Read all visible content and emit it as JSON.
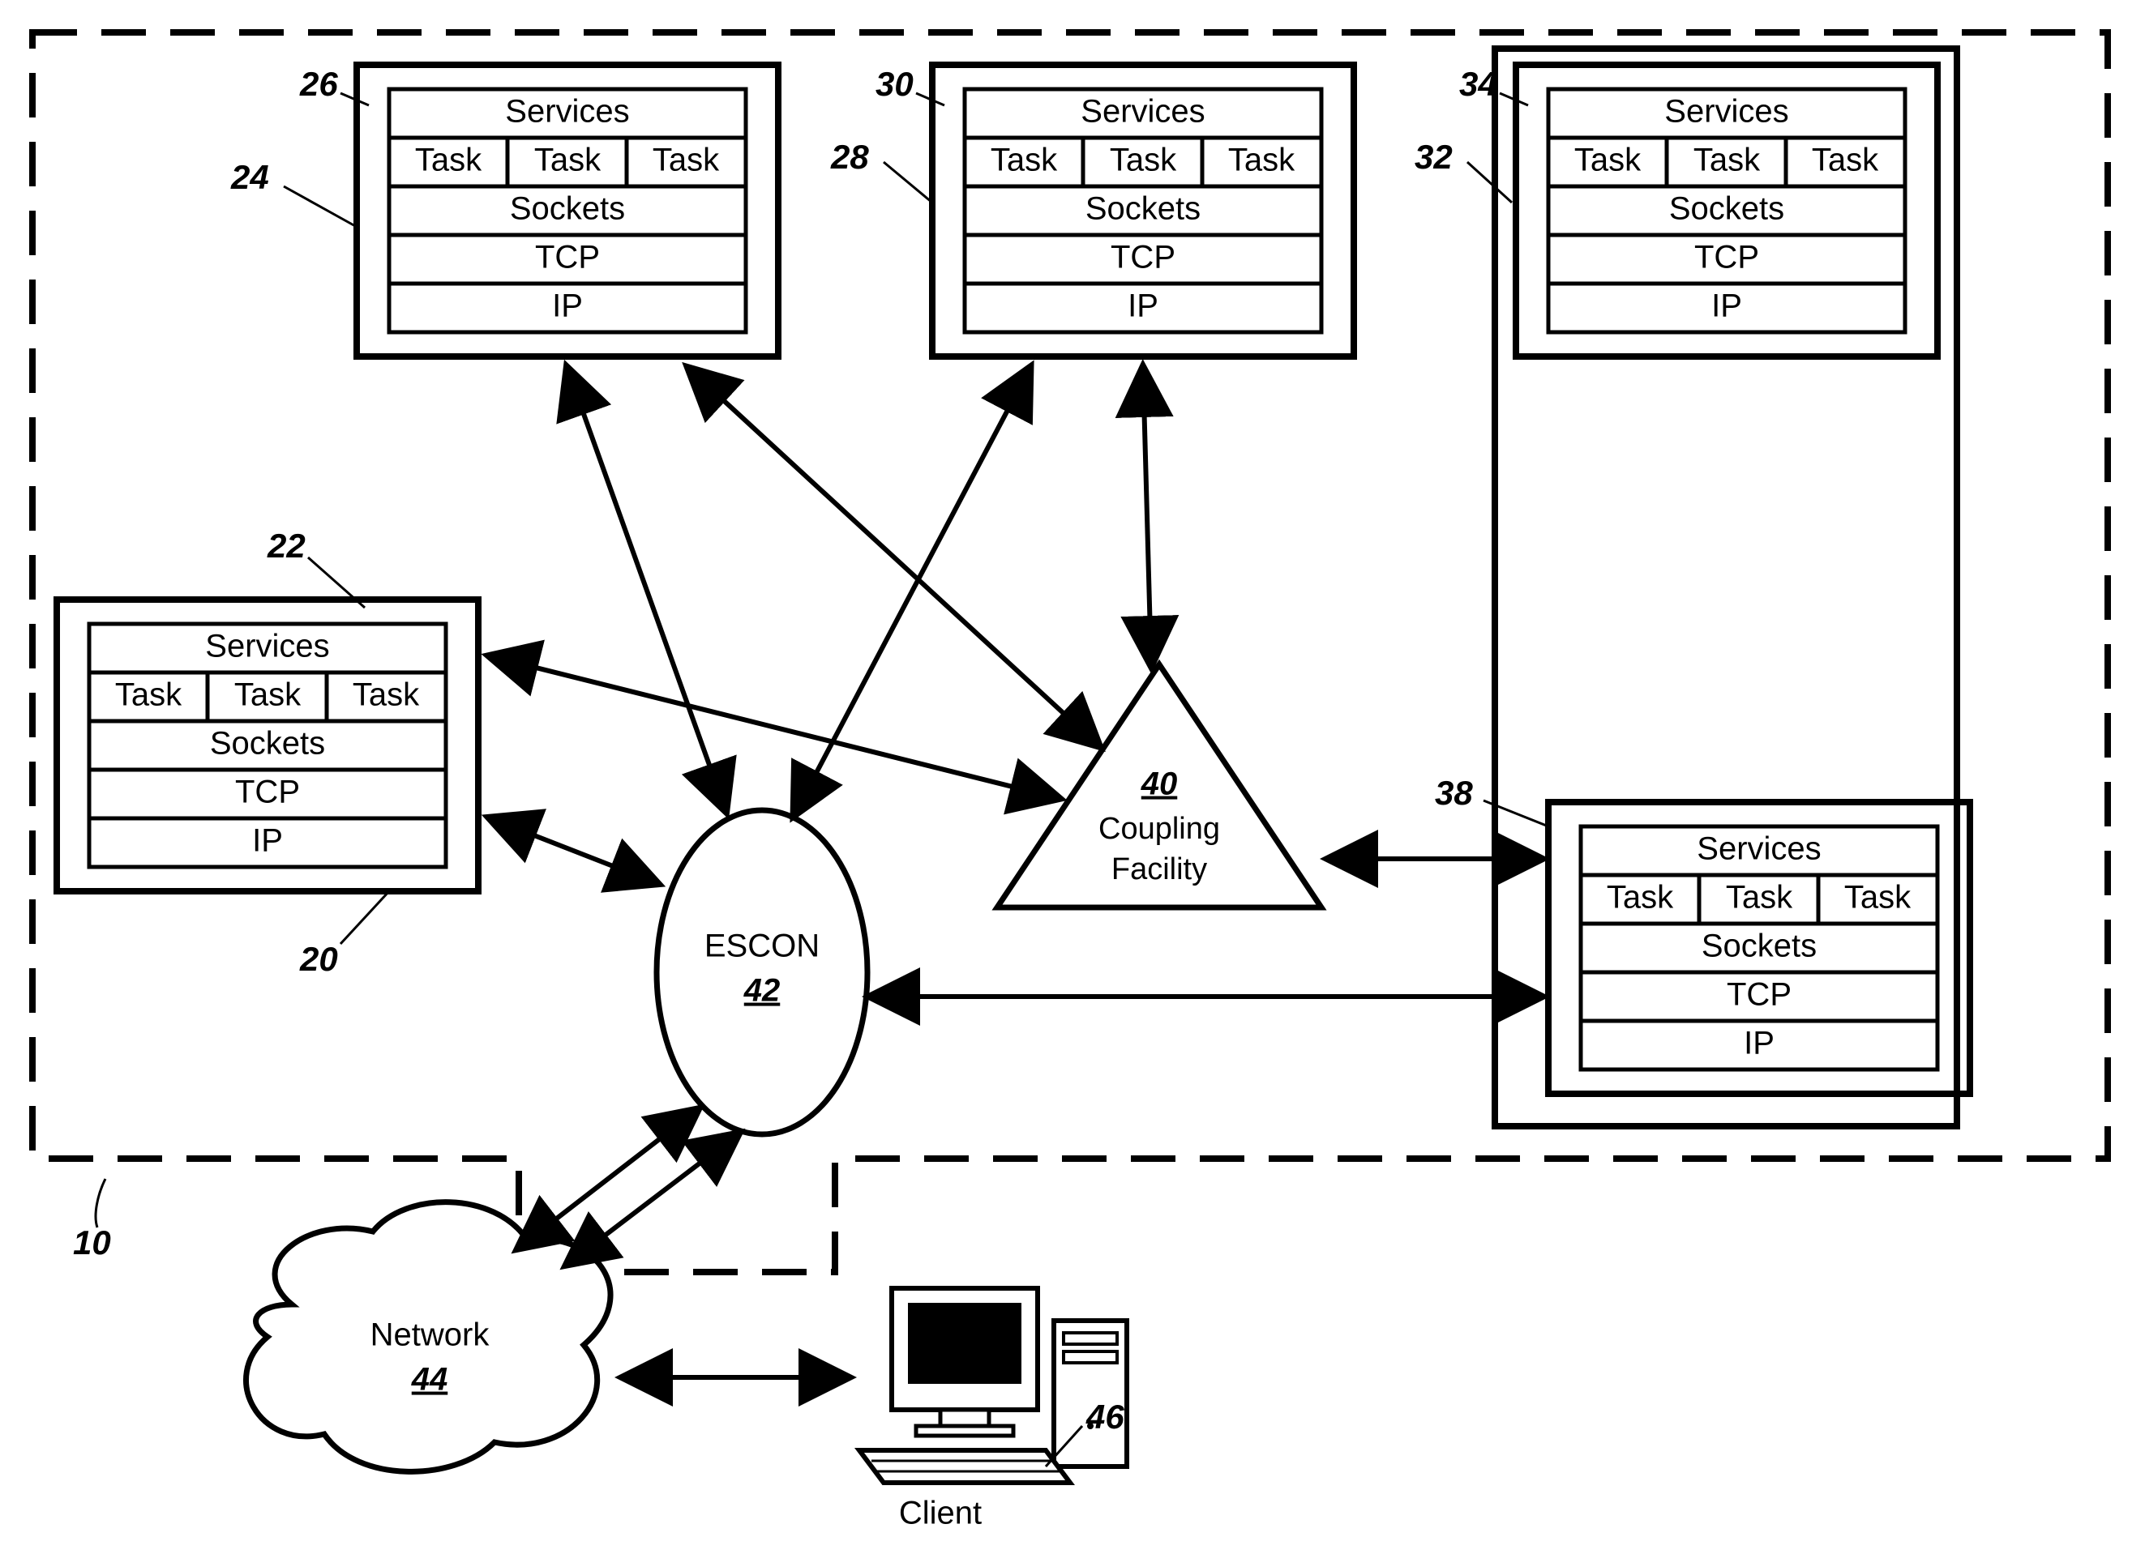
{
  "stack_rows": {
    "services": "Services",
    "tasks": [
      "Task",
      "Task",
      "Task"
    ],
    "sockets": "Sockets",
    "tcp": "TCP",
    "ip": "IP"
  },
  "labels": {
    "l10": "10",
    "l20": "20",
    "l22": "22",
    "l24": "24",
    "l26": "26",
    "l28": "28",
    "l30": "30",
    "l32": "32",
    "l34": "34",
    "l38": "38",
    "l40": "40",
    "l42": "42",
    "l44": "44",
    "l46": "46"
  },
  "escon": "ESCON",
  "coupling1": "Coupling",
  "coupling2": "Facility",
  "network": "Network",
  "client": "Client"
}
